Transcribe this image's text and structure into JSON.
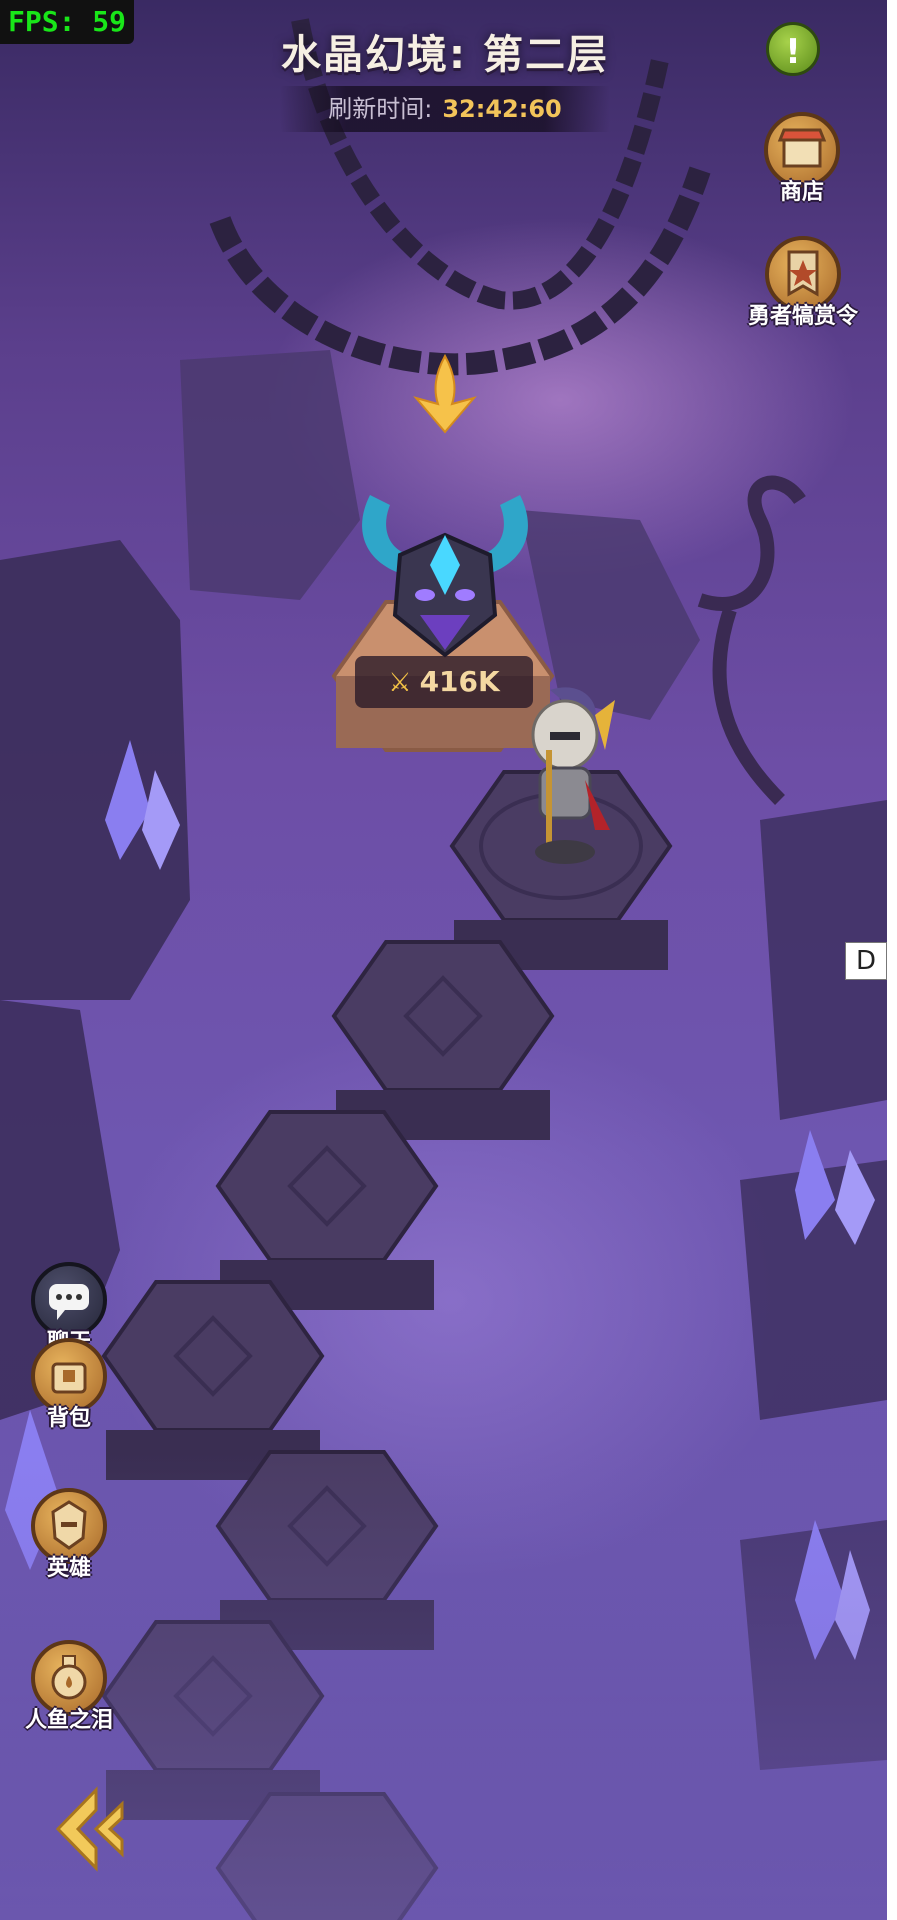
{
  "hud": {
    "fps": "FPS: 59",
    "title": "水晶幻境: 第二层",
    "refresh_label": "刷新时间:",
    "refresh_time": "32:42:60",
    "info_icon": "exclamation-icon"
  },
  "right_menu": [
    {
      "label": "商店",
      "icon": "shop-icon"
    },
    {
      "label": "勇者犒赏令",
      "icon": "banner-icon"
    }
  ],
  "left_menu": [
    {
      "label": "聊天",
      "icon": "chat-icon"
    },
    {
      "label": "背包",
      "icon": "bag-icon"
    },
    {
      "label": "英雄",
      "icon": "helmet-icon"
    },
    {
      "label": "人鱼之泪",
      "icon": "potion-icon"
    }
  ],
  "enemy": {
    "power": "416K",
    "power_icon": "crossed-swords-icon",
    "icon": "horned-helmet-boss-icon"
  },
  "misc": {
    "side_badge": "D",
    "back_icon": "back-chevrons-icon"
  }
}
